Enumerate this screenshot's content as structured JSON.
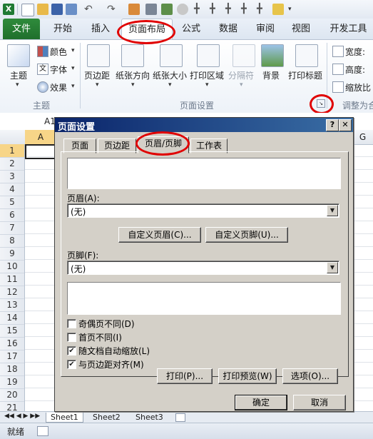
{
  "ribbon_tabs": [
    "文件",
    "开始",
    "插入",
    "页面布局",
    "公式",
    "数据",
    "审阅",
    "视图",
    "开发工具"
  ],
  "theme_group": {
    "label": "主题",
    "buttons": [
      "主题",
      "颜色",
      "字体",
      "效果"
    ]
  },
  "page_setup_group": {
    "label": "页面设置",
    "buttons": [
      "页边距",
      "纸张方向",
      "纸张大小",
      "打印区域",
      "分隔符",
      "背景",
      "打印标题"
    ]
  },
  "scale_group": {
    "label": "调整为合",
    "items": [
      "宽度:",
      "高度:",
      "缩放比"
    ]
  },
  "sheet": {
    "cell_ref": "A1",
    "col_headers": [
      "A",
      "G"
    ],
    "rows": [
      "1",
      "2",
      "3",
      "4",
      "5",
      "6",
      "7",
      "8",
      "9",
      "10",
      "11",
      "12",
      "13",
      "14",
      "15",
      "16",
      "17",
      "18",
      "19",
      "20",
      "21"
    ],
    "sheet_tabs": [
      "Sheet1",
      "Sheet2",
      "Sheet3"
    ],
    "status": "就绪"
  },
  "dialog": {
    "title": "页面设置",
    "help": "?",
    "close": "✕",
    "tabs": [
      "页面",
      "页边距",
      "页眉/页脚",
      "工作表"
    ],
    "header_label": "页眉(A):",
    "header_value": "(无)",
    "custom_header": "自定义页眉(C)...",
    "custom_footer": "自定义页脚(U)...",
    "footer_label": "页脚(F):",
    "footer_value": "(无)",
    "options": [
      {
        "label": "奇偶页不同(D)",
        "checked": false
      },
      {
        "label": "首页不同(I)",
        "checked": false
      },
      {
        "label": "随文档自动缩放(L)",
        "checked": true
      },
      {
        "label": "与页边距对齐(M)",
        "checked": true
      }
    ],
    "print": "打印(P)...",
    "print_preview": "打印预览(W)",
    "options_btn": "选项(O)...",
    "ok": "确定",
    "cancel": "取消"
  },
  "colors": {
    "accent_red": "#e00000",
    "file_tab": "#1f6f2c",
    "dialog_title": "#0a246a"
  }
}
